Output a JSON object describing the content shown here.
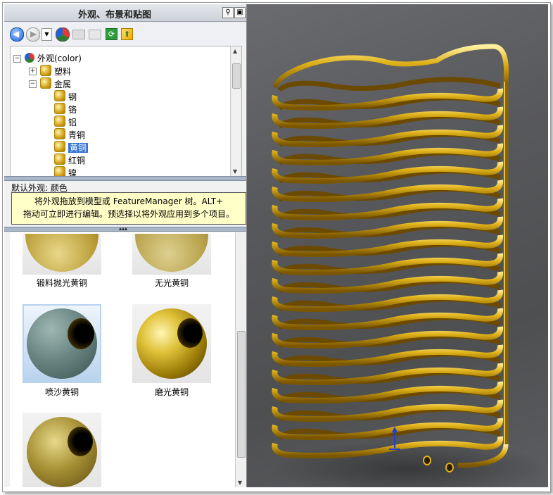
{
  "pane": {
    "title": "外观、布景和贴图",
    "pin_icon": "pin-icon",
    "close_icon": "dock-icon"
  },
  "toolbar": {
    "icons": [
      "back-icon",
      "forward-icon",
      "dropdown-icon",
      "appearance-icon",
      "open-folder-icon",
      "folder-icon",
      "refresh-icon",
      "export-icon"
    ]
  },
  "tree": {
    "root": "外观(color)",
    "plastic": "塑料",
    "metal": "金属",
    "children": [
      "钢",
      "铬",
      "铝",
      "青铜",
      "黄铜",
      "红铜",
      "镍"
    ],
    "selected": "黄铜"
  },
  "info": {
    "default_appearance": "默认外观: 颜色",
    "tooltip_line1": "将外观拖放到模型或 FeatureManager 树。ALT+",
    "tooltip_line2": "拖动可立即进行编辑。预选择以将外观应用到多个项目。"
  },
  "gallery": {
    "items": [
      {
        "label": "锻料抛光黄铜"
      },
      {
        "label": "无光黄铜"
      },
      {
        "label": "喷沙黄铜"
      },
      {
        "label": "磨光黄铜"
      },
      {
        "label": ""
      }
    ]
  },
  "colors": {
    "brass": "#d4a30c",
    "brass_dark": "#7a5600",
    "selection": "#3373d4",
    "tooltip_bg": "#ffffc8"
  }
}
